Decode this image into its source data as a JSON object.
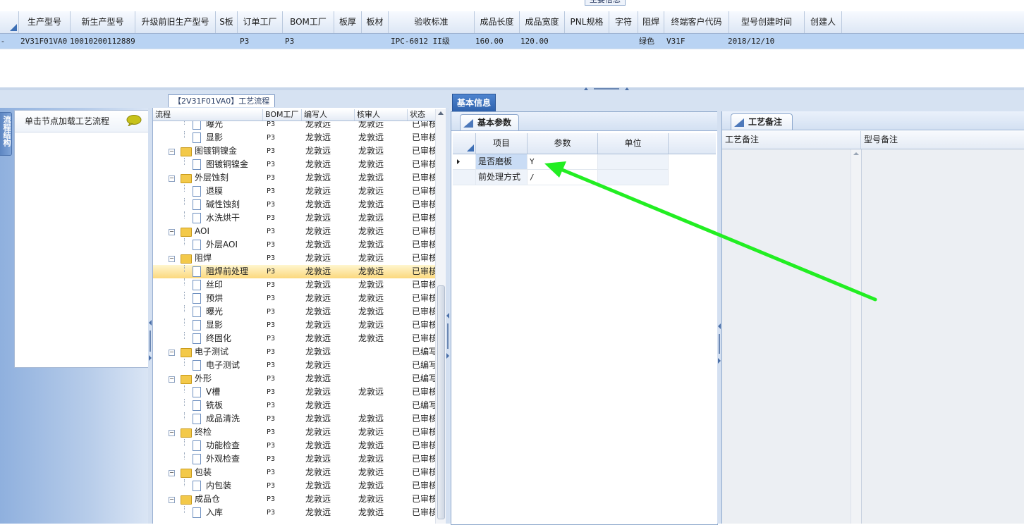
{
  "top_grid": {
    "caption": "主要信息",
    "columns": [
      "生产型号",
      "新生产型号",
      "升级前旧生产型号",
      "S板",
      "订单工厂",
      "BOM工厂",
      "板厚",
      "板材",
      "验收标准",
      "成品长度",
      "成品宽度",
      "PNL规格",
      "字符",
      "阻焊",
      "终端客户代码",
      "型号创建时间",
      "创建人"
    ],
    "row": {
      "production_model": "2V31F01VA0",
      "new_model": "10010200112889",
      "old_model": "",
      "s_board": "",
      "order_factory": "P3",
      "bom_factory": "P3",
      "thickness": "",
      "material": "",
      "standard": "IPC-6012 II级",
      "length": "160.00",
      "width": "120.00",
      "pnl": "",
      "character": "",
      "solder_mask": "绿色",
      "customer_code": "V31F",
      "created_time": "2018/12/10",
      "creator": ""
    }
  },
  "left_panel": {
    "vertical_tab": "流程结构",
    "hint": "单击节点加载工艺流程"
  },
  "tree_panel": {
    "tab_title": "【2V31F01VA0】工艺流程",
    "headers": [
      "流程",
      "BOM工厂",
      "编写人",
      "核审人",
      "状态"
    ],
    "rows": [
      {
        "name": "曝光",
        "level": 2,
        "bom": "P3",
        "writer": "龙敦远",
        "reviewer": "龙敦远",
        "status": "已审核"
      },
      {
        "name": "显影",
        "level": 2,
        "bom": "P3",
        "writer": "龙敦远",
        "reviewer": "龙敦远",
        "status": "已审核"
      },
      {
        "name": "图镀铜镍金",
        "level": 1,
        "bom": "P3",
        "writer": "龙敦远",
        "reviewer": "龙敦远",
        "status": "已审核"
      },
      {
        "name": "图镀铜镍金",
        "level": 2,
        "bom": "P3",
        "writer": "龙敦远",
        "reviewer": "龙敦远",
        "status": "已审核"
      },
      {
        "name": "外层蚀刻",
        "level": 1,
        "bom": "P3",
        "writer": "龙敦远",
        "reviewer": "龙敦远",
        "status": "已审核"
      },
      {
        "name": "退膜",
        "level": 2,
        "bom": "P3",
        "writer": "龙敦远",
        "reviewer": "龙敦远",
        "status": "已审核"
      },
      {
        "name": "碱性蚀刻",
        "level": 2,
        "bom": "P3",
        "writer": "龙敦远",
        "reviewer": "龙敦远",
        "status": "已审核"
      },
      {
        "name": "水洗烘干",
        "level": 2,
        "bom": "P3",
        "writer": "龙敦远",
        "reviewer": "龙敦远",
        "status": "已审核"
      },
      {
        "name": "AOI",
        "level": 1,
        "bom": "P3",
        "writer": "龙敦远",
        "reviewer": "龙敦远",
        "status": "已审核"
      },
      {
        "name": "外层AOI",
        "level": 2,
        "bom": "P3",
        "writer": "龙敦远",
        "reviewer": "龙敦远",
        "status": "已审核"
      },
      {
        "name": "阻焊",
        "level": 1,
        "bom": "P3",
        "writer": "龙敦远",
        "reviewer": "龙敦远",
        "status": "已审核"
      },
      {
        "name": "阻焊前处理",
        "level": 2,
        "bom": "P3",
        "writer": "龙敦远",
        "reviewer": "龙敦远",
        "status": "已审核",
        "selected": true
      },
      {
        "name": "丝印",
        "level": 2,
        "bom": "P3",
        "writer": "龙敦远",
        "reviewer": "龙敦远",
        "status": "已审核"
      },
      {
        "name": "预烘",
        "level": 2,
        "bom": "P3",
        "writer": "龙敦远",
        "reviewer": "龙敦远",
        "status": "已审核"
      },
      {
        "name": "曝光",
        "level": 2,
        "bom": "P3",
        "writer": "龙敦远",
        "reviewer": "龙敦远",
        "status": "已审核"
      },
      {
        "name": "显影",
        "level": 2,
        "bom": "P3",
        "writer": "龙敦远",
        "reviewer": "龙敦远",
        "status": "已审核"
      },
      {
        "name": "终固化",
        "level": 2,
        "bom": "P3",
        "writer": "龙敦远",
        "reviewer": "龙敦远",
        "status": "已审核"
      },
      {
        "name": "电子测试",
        "level": 1,
        "bom": "P3",
        "writer": "龙敦远",
        "reviewer": "",
        "status": "已编写"
      },
      {
        "name": "电子测试",
        "level": 2,
        "bom": "P3",
        "writer": "龙敦远",
        "reviewer": "",
        "status": "已编写"
      },
      {
        "name": "外形",
        "level": 1,
        "bom": "P3",
        "writer": "龙敦远",
        "reviewer": "",
        "status": "已编写"
      },
      {
        "name": "V槽",
        "level": 2,
        "bom": "P3",
        "writer": "龙敦远",
        "reviewer": "龙敦远",
        "status": "已审核"
      },
      {
        "name": "铣板",
        "level": 2,
        "bom": "P3",
        "writer": "龙敦远",
        "reviewer": "",
        "status": "已编写"
      },
      {
        "name": "成品清洗",
        "level": 2,
        "bom": "P3",
        "writer": "龙敦远",
        "reviewer": "龙敦远",
        "status": "已审核"
      },
      {
        "name": "终检",
        "level": 1,
        "bom": "P3",
        "writer": "龙敦远",
        "reviewer": "龙敦远",
        "status": "已审核"
      },
      {
        "name": "功能检查",
        "level": 2,
        "bom": "P3",
        "writer": "龙敦远",
        "reviewer": "龙敦远",
        "status": "已审核"
      },
      {
        "name": "外观检查",
        "level": 2,
        "bom": "P3",
        "writer": "龙敦远",
        "reviewer": "龙敦远",
        "status": "已审核"
      },
      {
        "name": "包装",
        "level": 1,
        "bom": "P3",
        "writer": "龙敦远",
        "reviewer": "龙敦远",
        "status": "已审核"
      },
      {
        "name": "内包装",
        "level": 2,
        "bom": "P3",
        "writer": "龙敦远",
        "reviewer": "龙敦远",
        "status": "已审核"
      },
      {
        "name": "成品仓",
        "level": 1,
        "bom": "P3",
        "writer": "龙敦远",
        "reviewer": "龙敦远",
        "status": "已审核"
      },
      {
        "name": "入库",
        "level": 2,
        "bom": "P3",
        "writer": "龙敦远",
        "reviewer": "龙敦远",
        "status": "已审核"
      }
    ]
  },
  "basic_info": {
    "tab": "基本信息",
    "sub_tab": "基本参数",
    "headers": [
      "项目",
      "参数",
      "单位"
    ],
    "rows": [
      {
        "item": "是否磨板",
        "value": "Y",
        "unit": ""
      },
      {
        "item": "前处理方式",
        "value": "/",
        "unit": ""
      }
    ]
  },
  "notes": {
    "tab": "工艺备注",
    "headers": [
      "工艺备注",
      "型号备注"
    ]
  },
  "annotation": {
    "arrow_color": "#22ee22"
  }
}
